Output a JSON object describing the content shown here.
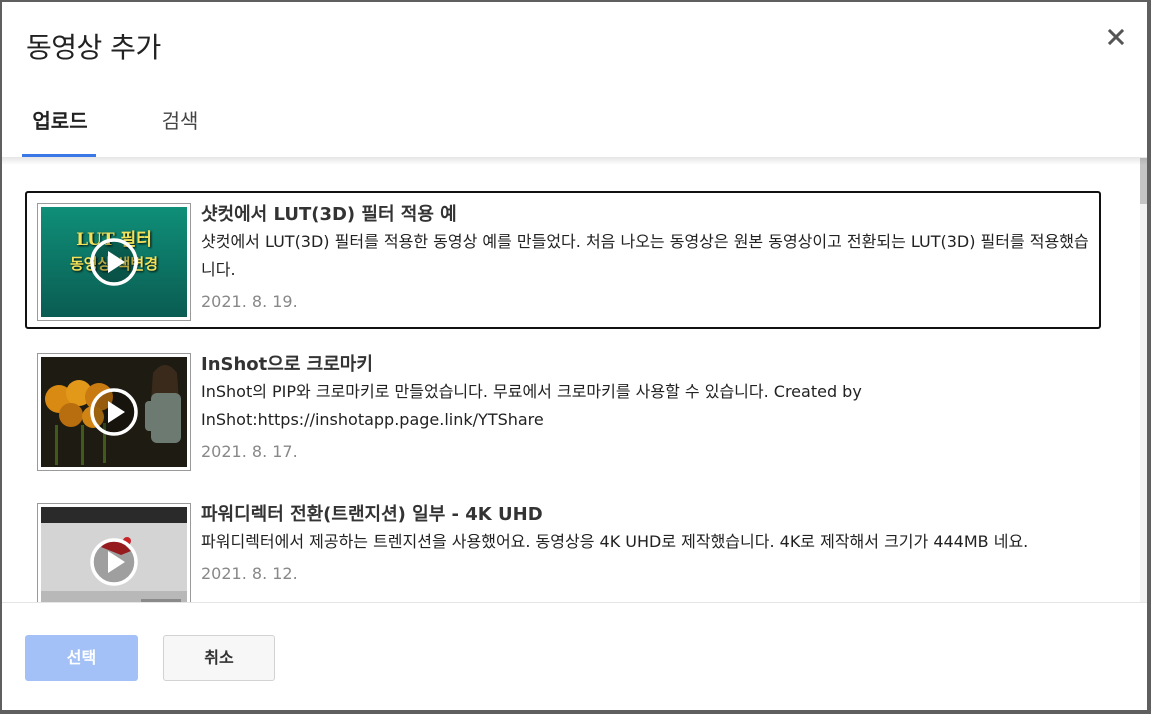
{
  "dialog": {
    "title": "동영상 추가",
    "close_icon": "close-icon"
  },
  "tabs": [
    {
      "label": "업로드",
      "active": true
    },
    {
      "label": "검색",
      "active": false
    }
  ],
  "videos": [
    {
      "title": "샷컷에서 LUT(3D) 필터 적용 예",
      "description": "샷컷에서 LUT(3D) 필터를 적용한 동영상 예를 만들었다. 처음 나오는 동영상은 원본 동영상이고 전환되는 LUT(3D) 필터를 적용했습니다.",
      "date": "2021. 8. 19.",
      "thumbnail_text_line1": "LUT 필터",
      "thumbnail_text_line2": "동영상 색변경",
      "selected": true
    },
    {
      "title": "InShot으로 크로마키",
      "description": "InShot의 PIP와 크로마키로 만들었습니다. 무료에서 크로마키를 사용할 수 있습니다. Created by InShot:https://inshotapp.page.link/YTShare",
      "date": "2021. 8. 17.",
      "selected": false
    },
    {
      "title": "파워디렉터 전환(트랜지션) 일부 - 4K UHD",
      "description": "파워디렉터에서 제공하는 트렌지션을 사용했어요. 동영상응 4K UHD로 제작했습니다. 4K로 제작해서 크기가 444MB 네요.",
      "date": "2021. 8. 12.",
      "selected": false
    }
  ],
  "footer": {
    "select_label": "선택",
    "cancel_label": "취소"
  },
  "colors": {
    "accent": "#3b78e7",
    "select_button_disabled": "#a3c1f6",
    "date_text": "#888888"
  }
}
